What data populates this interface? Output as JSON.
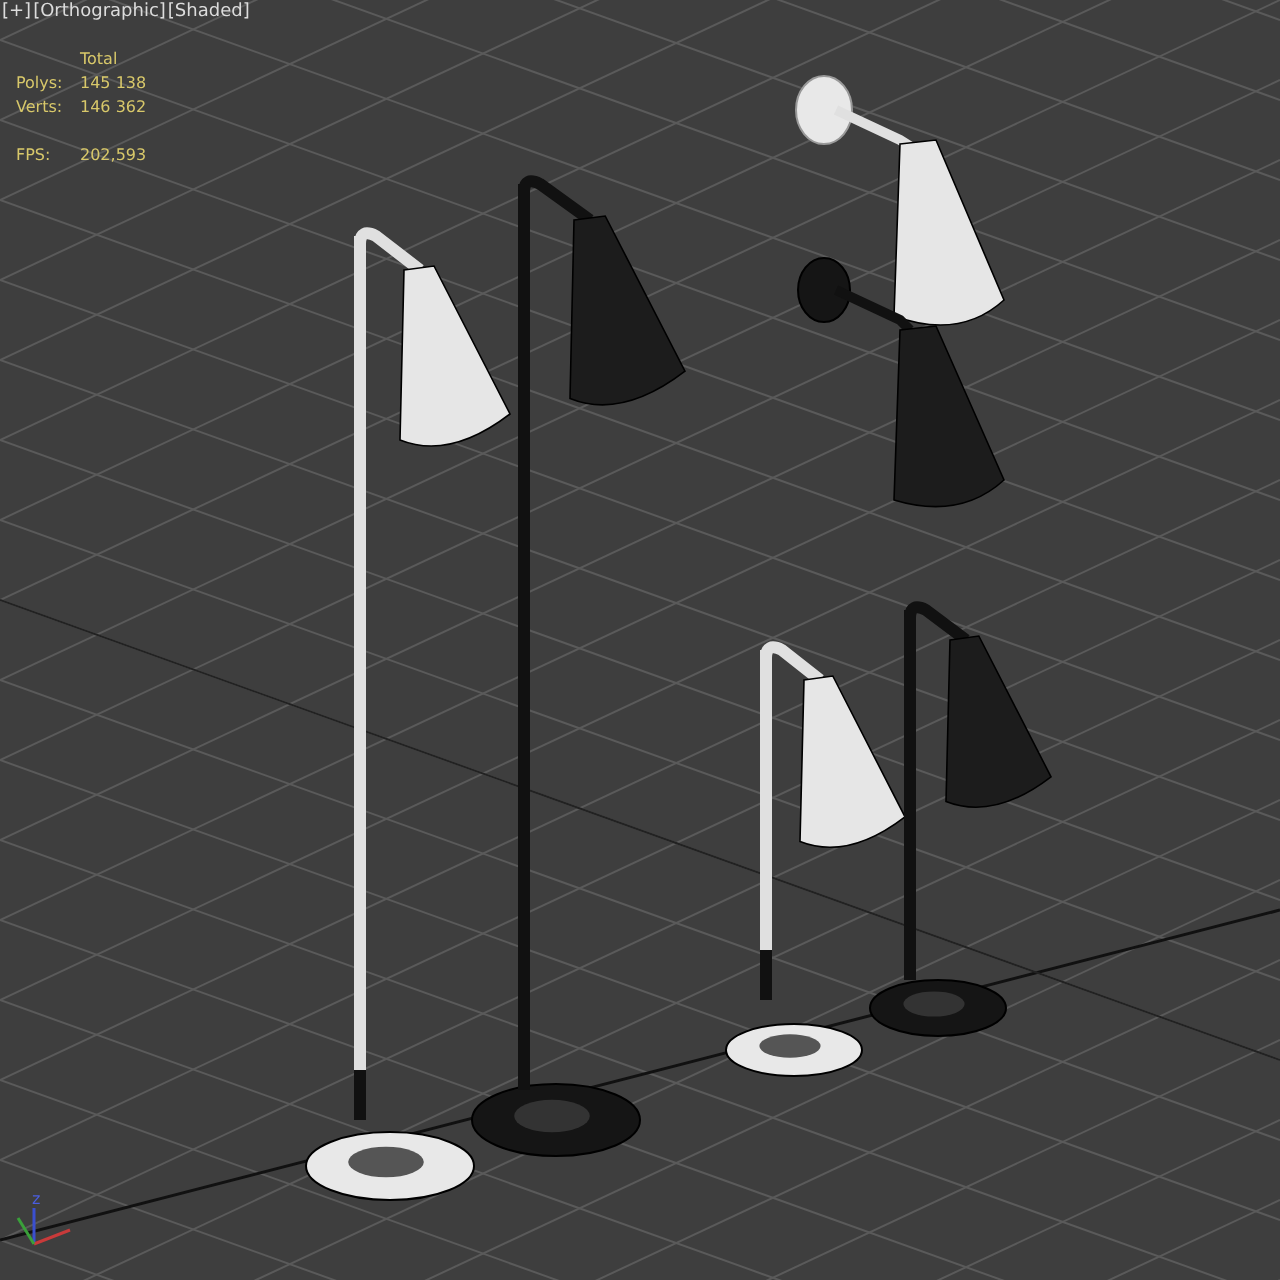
{
  "viewport": {
    "labels": [
      "[+]",
      "[Orthographic]",
      "[Shaded]"
    ]
  },
  "statistics": {
    "header": "Total",
    "rows": [
      {
        "label": "Polys:",
        "value": "145 138"
      },
      {
        "label": "Verts:",
        "value": "146 362"
      }
    ],
    "fps": {
      "label": "FPS:",
      "value": "202,593"
    }
  },
  "axis_gizmo": {
    "label": "z"
  }
}
